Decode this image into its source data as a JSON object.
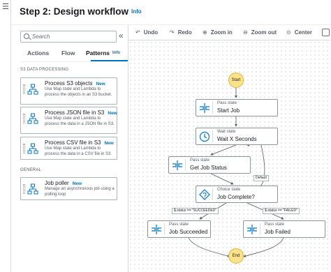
{
  "header": {
    "title": "Step 2: Design workflow",
    "info_link": "Info"
  },
  "search": {
    "placeholder": "Search"
  },
  "tabs": [
    {
      "label": "Actions",
      "active": false
    },
    {
      "label": "Flow",
      "active": false
    },
    {
      "label": "Patterns",
      "active": true,
      "info": "Info"
    }
  ],
  "sections": {
    "s3": "S3 DATA PROCESSING",
    "general": "GENERAL"
  },
  "patterns": [
    {
      "title": "Process S3 objects",
      "badge": "New",
      "desc": "Use Map state and Lambda to process the objects in an S3 bucket."
    },
    {
      "title": "Process JSON file in S3",
      "badge": "New",
      "desc": "Use Map state and Lambda to process the data in a JSON file in S3."
    },
    {
      "title": "Process CSV file in S3",
      "badge": "New",
      "desc": "Use Map state and Lambda to process the data in a CSV file in S3."
    },
    {
      "title": "Job poller",
      "badge": "New",
      "desc": "Manage an asynchronous job using a polling loop"
    }
  ],
  "toolbar": {
    "undo": "Undo",
    "redo": "Redo",
    "zoom_in": "Zoom in",
    "zoom_out": "Zoom out",
    "center": "Center"
  },
  "workflow": {
    "start": "Start",
    "end": "End",
    "nodes": {
      "start_job": {
        "type": "Pass state",
        "name": "Start Job"
      },
      "wait": {
        "type": "Wait state",
        "name": "Wait X Seconds"
      },
      "get_status": {
        "type": "Pass state",
        "name": "Get Job Status"
      },
      "choice": {
        "type": "Choice state",
        "name": "Job Complete?"
      },
      "succeeded": {
        "type": "Pass state",
        "name": "Job Succeeded"
      },
      "failed": {
        "type": "Pass state",
        "name": "Job Failed"
      }
    },
    "edge_labels": {
      "default": "Default",
      "succeeded_rule": "$.status == \"SUCCEEDED\"",
      "failed_rule": "$.status == \"FAILED\""
    }
  },
  "colors": {
    "accent": "#0073bb",
    "terminal_fill": "#fce28a",
    "node_border": "#879596"
  }
}
